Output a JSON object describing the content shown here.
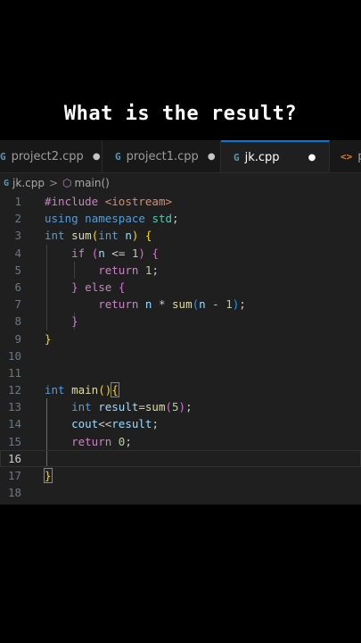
{
  "question": "What is the result?",
  "tabs": [
    {
      "label": "project2.cpp",
      "icon": "cpp-file-icon",
      "dirty": "●"
    },
    {
      "label": "project1.cpp",
      "icon": "cpp-file-icon",
      "dirty": "●"
    },
    {
      "label": "jk.cpp",
      "icon": "cpp-file-icon",
      "dirty": "●",
      "active": true
    },
    {
      "label": "p",
      "icon": "code-file-icon"
    }
  ],
  "breadcrumb": {
    "file": "jk.cpp",
    "separator": ">",
    "symbol": "main()"
  },
  "line_numbers": [
    "1",
    "2",
    "3",
    "4",
    "5",
    "6",
    "7",
    "8",
    "9",
    "10",
    "11",
    "12",
    "13",
    "14",
    "15",
    "16",
    "17",
    "18"
  ],
  "code_lines": [
    "#include <iostream>",
    "using namespace std;",
    "int sum(int n) {",
    "    if (n <= 1) {",
    "        return 1;",
    "    } else {",
    "        return n * sum(n - 1);",
    "    }",
    "}",
    "",
    "",
    "int main(){",
    "    int result=sum(5);",
    "    cout<<result;",
    "    return 0;",
    "",
    "}",
    ""
  ],
  "current_line": 16,
  "colors": {
    "accent": "#0078d4",
    "keyword": "#569cd6",
    "control": "#c586c0",
    "function": "#dcdcaa",
    "number": "#b5cea8"
  }
}
